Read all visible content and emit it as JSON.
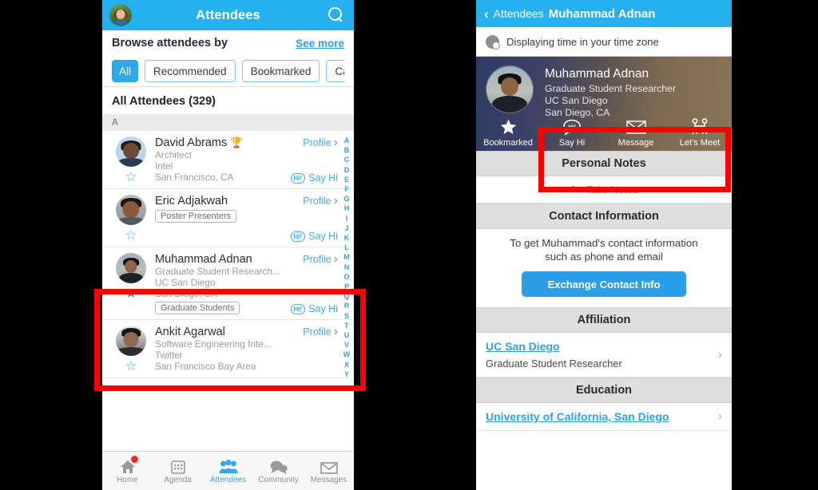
{
  "left": {
    "navbar": {
      "title": "Attendees",
      "avatar_name": "user-avatar",
      "search_icon": "search-icon"
    },
    "browse": {
      "label": "Browse attendees by",
      "see_more": "See more"
    },
    "chips": [
      {
        "label": "All",
        "active": true
      },
      {
        "label": "Recommended",
        "active": false
      },
      {
        "label": "Bookmarked",
        "active": false
      },
      {
        "label": "Cat",
        "active": false,
        "clipped": true
      }
    ],
    "list_title": "All Attendees (329)",
    "alpha_header": "A",
    "alpha_index": [
      "A",
      "B",
      "C",
      "D",
      "E",
      "F",
      "G",
      "H",
      "I",
      "J",
      "K",
      "L",
      "M",
      "N",
      "O",
      "P",
      "Q",
      "R",
      "S",
      "T",
      "U",
      "V",
      "W",
      "X",
      "Y"
    ],
    "rows": [
      {
        "name": "David Abrams",
        "trophy": "🏆",
        "title": "Architect",
        "company": "Intel",
        "location": "San Francisco, CA",
        "tag": "",
        "profile": "Profile",
        "say_hi": "Say Hi",
        "hi_badge": "Hi!",
        "bookmarked": false
      },
      {
        "name": "Eric Adjakwah",
        "trophy": "",
        "title": "",
        "company": "",
        "location": "",
        "tag": "Poster Presenters",
        "profile": "Profile",
        "say_hi": "Say Hi",
        "hi_badge": "Hi!",
        "bookmarked": false
      },
      {
        "name": "Muhammad Adnan",
        "trophy": "",
        "title": "Graduate Student Research...",
        "company": "UC San Diego",
        "location": "San Diego, CA",
        "tag": "Graduate Students",
        "profile": "Profile",
        "say_hi": "Say Hi",
        "hi_badge": "Hi!",
        "bookmarked": true
      },
      {
        "name": "Ankit Agarwal",
        "trophy": "",
        "title": "Software Engineering Inte...",
        "company": "Twitter",
        "location": "San Francisco Bay Area",
        "tag": "",
        "profile": "Profile",
        "say_hi": "",
        "hi_badge": "",
        "bookmarked": false
      }
    ],
    "tabs": [
      {
        "label": "Home",
        "icon": "home-icon",
        "active": false,
        "badge": true
      },
      {
        "label": "Agenda",
        "icon": "calendar-icon",
        "active": false,
        "badge": false
      },
      {
        "label": "Attendees",
        "icon": "people-icon",
        "active": true,
        "badge": false
      },
      {
        "label": "Community",
        "icon": "chat-icon",
        "active": false,
        "badge": false
      },
      {
        "label": "Messages",
        "icon": "envelope-icon",
        "active": false,
        "badge": false
      }
    ]
  },
  "right": {
    "navbar": {
      "back_label": "Attendees",
      "title": "Muhammad Adnan",
      "back_icon": "chevron-left-icon"
    },
    "timezone": {
      "text": "Displaying time in your time zone",
      "icon": "globe-clock-icon"
    },
    "hero": {
      "name": "Muhammad Adnan",
      "title": "Graduate Student Researcher",
      "org": "UC San Diego",
      "location": "San Diego, CA",
      "actions": [
        {
          "label": "Bookmarked",
          "icon": "star-filled-icon"
        },
        {
          "label": "Say Hi",
          "icon": "hi-bubble-icon"
        },
        {
          "label": "Message",
          "icon": "envelope-icon"
        },
        {
          "label": "Let's Meet",
          "icon": "handshake-icon"
        }
      ]
    },
    "personal_notes": {
      "header": "Personal Notes",
      "take_notes": "Take Notes",
      "pencil_icon": "pencil-icon"
    },
    "contact": {
      "header": "Contact Information",
      "line1": "To get Muhammad's contact information",
      "line2": "such as phone and email",
      "button": "Exchange Contact Info"
    },
    "affiliation": {
      "header": "Affiliation",
      "link": "UC San Diego",
      "subtext": "Graduate Student Researcher"
    },
    "education": {
      "header": "Education",
      "link": "University of California, San Diego"
    }
  },
  "colors": {
    "brand_blue": "#25b0ef",
    "link_blue": "#2ba3ee",
    "highlight_red": "#ff0000",
    "section_gray": "#dedede"
  }
}
